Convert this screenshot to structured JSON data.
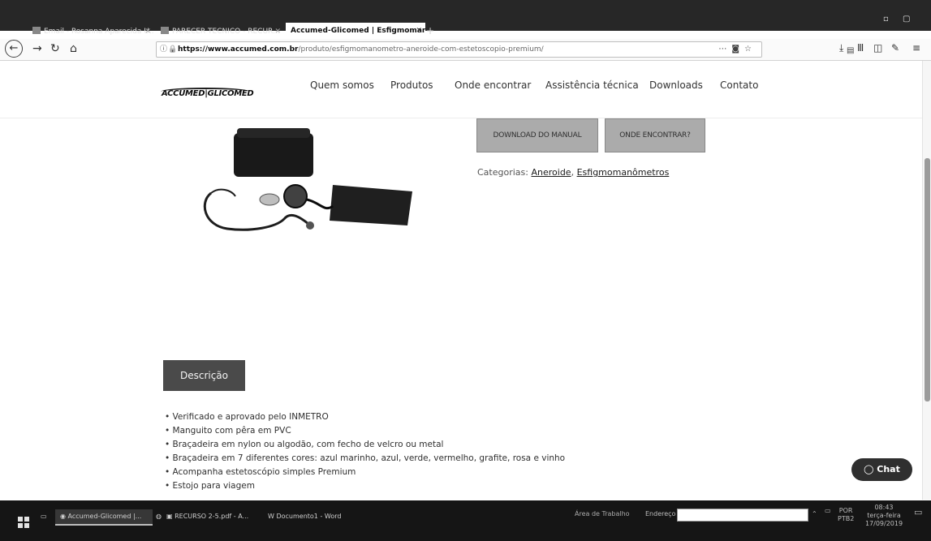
{
  "browser": {
    "tabs": [
      {
        "label": "Email - Rosanna Aparecida U...",
        "active": false
      },
      {
        "label": "PARECER TECNICO - RECUR...",
        "active": false
      },
      {
        "label": "Accumed-Glicomed | Esfigmoman",
        "active": true
      }
    ],
    "url_domain": "https://www.accumed.com.br",
    "url_path": "/produto/esfigmomanometro-aneroide-com-estetoscopio-premium/"
  },
  "site": {
    "logo": "ACCUMED|GLICOMED",
    "menu": [
      "Quem somos",
      "Produtos",
      "Onde encontrar",
      "Assistência técnica",
      "Downloads",
      "Contato"
    ]
  },
  "product": {
    "download_button": "DOWNLOAD DO MANUAL",
    "where_button": "ONDE ENCONTRAR?",
    "categories_label": "Categorias:",
    "category_1": "Aneroide",
    "separator": ",",
    "category_2": "Esfigmomanômetros",
    "description_tab": "Descrição",
    "features": [
      "Verificado e aprovado pelo INMETRO",
      "Manguito com pêra em PVC",
      "Braçadeira em nylon ou algodão, com fecho de velcro ou metal",
      "Braçadeira em 7 diferentes cores: azul marinho, azul, verde, vermelho, grafite, rosa e vinho",
      "Acompanha estetoscópio simples Premium",
      "Estojo para viagem"
    ]
  },
  "chat": {
    "label": "Chat"
  },
  "taskbar": {
    "apps": [
      "Accumed-Glicomed |...",
      "RECURSO 2-5.pdf - A...",
      "Documento1 - Word"
    ],
    "area_label": "Área de Trabalho",
    "address_label": "Endereço",
    "lang": "POR",
    "kb": "PTB2",
    "time": "08:43",
    "day": "terça-feira",
    "date": "17/09/2019"
  }
}
